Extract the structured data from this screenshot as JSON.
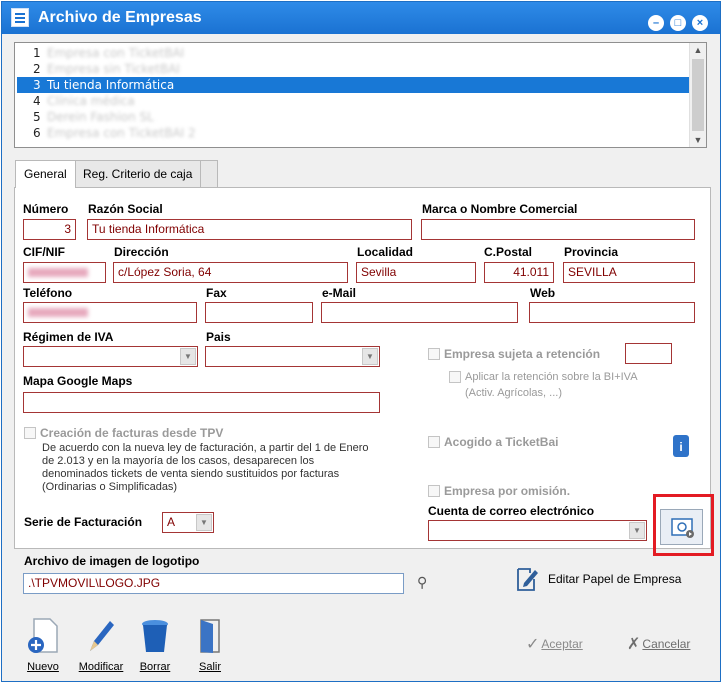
{
  "window": {
    "title": "Archivo de Empresas"
  },
  "list": {
    "items": [
      {
        "num": "1",
        "name": "Empresa con TicketBAI",
        "blurred": true
      },
      {
        "num": "2",
        "name": "Empresa sin TicketBAI",
        "blurred": true
      },
      {
        "num": "3",
        "name": "Tu tienda Informática",
        "blurred": false,
        "selected": true
      },
      {
        "num": "4",
        "name": "Clínica médica",
        "blurred": true
      },
      {
        "num": "5",
        "name": "Derein Fashion SL",
        "blurred": true
      },
      {
        "num": "6",
        "name": "Empresa con TicketBAI 2",
        "blurred": true
      }
    ]
  },
  "tabs": {
    "general": "General",
    "criterio": "Reg. Criterio de caja"
  },
  "labels": {
    "numero": "Número",
    "razon": "Razón Social",
    "marca": "Marca o Nombre Comercial",
    "cif": "CIF/NIF",
    "direccion": "Dirección",
    "localidad": "Localidad",
    "cpostal": "C.Postal",
    "provincia": "Provincia",
    "telefono": "Teléfono",
    "fax": "Fax",
    "email": "e-Mail",
    "web": "Web",
    "regimen": "Régimen de IVA",
    "pais": "Pais",
    "mapa": "Mapa Google Maps",
    "retencion": "Empresa sujeta a retención",
    "aplicar": "Aplicar la retención sobre la BI+IVA",
    "aplicar2": "(Activ. Agrícolas, ...)",
    "facturas_tpv": "Creación de facturas desde TPV",
    "facturas_desc": "De acuerdo con la nueva ley de facturación, a partir del 1 de Enero de 2.013 y en la mayoría de los casos, desaparecen los denominados tickets de venta siendo sustituidos por facturas (Ordinarias o Simplificadas)",
    "ticketbai": "Acogido a TicketBai",
    "por_omision": "Empresa por omisión.",
    "serie": "Serie de Facturación",
    "cuenta": "Cuenta de correo electrónico",
    "logotipo": "Archivo de imagen de logotipo",
    "editar_papel": "Editar Papel de Empresa"
  },
  "values": {
    "numero": "3",
    "razon": "Tu tienda Informática",
    "marca": "",
    "direccion": "c/López Soria, 64",
    "localidad": "Sevilla",
    "cpostal": "41.011",
    "provincia": "SEVILLA",
    "serie": "A",
    "logotipo": ".\\TPVMOVIL\\LOGO.JPG"
  },
  "buttons": {
    "nuevo": "Nuevo",
    "modificar": "Modificar",
    "borrar": "Borrar",
    "salir": "Salir",
    "aceptar": "Aceptar",
    "cancelar": "Cancelar"
  },
  "colors": {
    "titlebar": "#1a72d2",
    "field_border": "#a43535",
    "highlight": "#e31b23"
  }
}
